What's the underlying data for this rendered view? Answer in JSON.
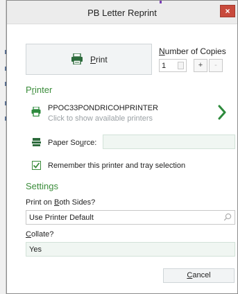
{
  "window": {
    "title": "PB Letter Reprint",
    "close_glyph": "×"
  },
  "print": {
    "label_u": "P",
    "label_rest": "rint",
    "icon": "printer-icon"
  },
  "copies": {
    "label_u": "N",
    "label_rest": "umber of Copies",
    "value": "1",
    "plus": "+",
    "minus": "-"
  },
  "printer_section": {
    "title_pre": "P",
    "title_u": "r",
    "title_post": "inter",
    "printer_name": "PPOC33PONDRICOHPRINTER",
    "printer_hint": "Click to show available printers",
    "paper_source_pre": "Paper So",
    "paper_source_u": "u",
    "paper_source_post": "rce:",
    "paper_source_value": "",
    "remember_label": "Remember this printer and tray selection",
    "remember_checked": true
  },
  "settings": {
    "title": "Settings",
    "both_sides_pre": "Print on ",
    "both_sides_u": "B",
    "both_sides_post": "oth Sides?",
    "both_sides_value": "Use Printer Default",
    "collate_u": "C",
    "collate_post": "ollate?",
    "collate_value": "Yes"
  },
  "footer": {
    "cancel_u": "C",
    "cancel_rest": "ancel"
  },
  "colors": {
    "accent_green": "#3a8c3a",
    "close_red": "#c84a3c"
  }
}
